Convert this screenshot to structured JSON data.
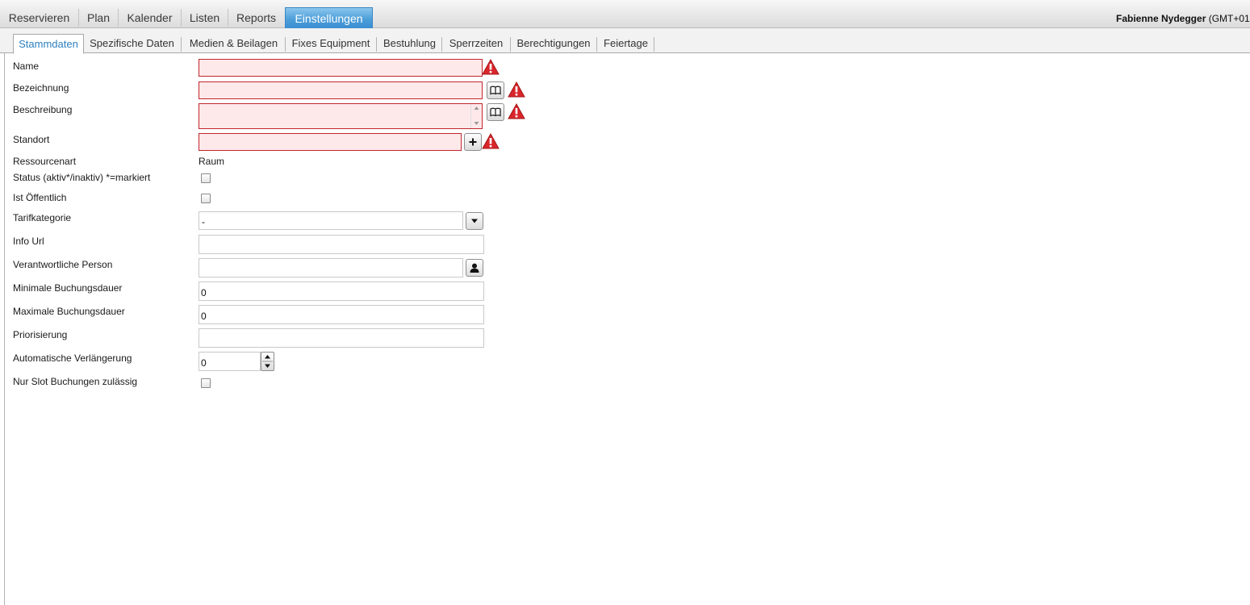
{
  "topnav": {
    "items": [
      "Reservieren",
      "Plan",
      "Kalender",
      "Listen",
      "Reports",
      "Einstellungen"
    ],
    "active": "Einstellungen",
    "user_name": "Fabienne Nydegger",
    "user_tz": "(GMT+01"
  },
  "subtabs": {
    "items": [
      "Stammdaten",
      "Spezifische Daten",
      "Medien & Beilagen",
      "Fixes Equipment",
      "Bestuhlung",
      "Sperrzeiten",
      "Berechtigungen",
      "Feiertage"
    ],
    "active": "Stammdaten"
  },
  "form": {
    "name_label": "Name",
    "bezeichnung_label": "Bezeichnung",
    "beschreibung_label": "Beschreibung",
    "standort_label": "Standort",
    "ressourcenart_label": "Ressourcenart",
    "ressourcenart_value": "Raum",
    "status_label": "Status (aktiv*/inaktiv) *=markiert",
    "oeffentlich_label": "Ist Öffentlich",
    "tarifkategorie_label": "Tarifkategorie",
    "tarifkategorie_value": "-",
    "info_url_label": "Info Url",
    "verantwortlich_label": "Verantwortliche Person",
    "min_dauer_label": "Minimale Buchungsdauer",
    "min_dauer_value": "0",
    "max_dauer_label": "Maximale Buchungsdauer",
    "max_dauer_value": "0",
    "priorisierung_label": "Priorisierung",
    "auto_verl_label": "Automatische Verlängerung",
    "auto_verl_value": "0",
    "slot_label": "Nur Slot Buchungen zulässig"
  },
  "icons": {
    "warning": "warning-icon",
    "translate": "book-icon",
    "add": "plus-icon",
    "dropdown": "chevron-down-icon",
    "person": "person-icon"
  },
  "colors": {
    "invalid_bg": "#fde8ea",
    "invalid_border": "#c0272d",
    "active_tab": "#4d9fd9",
    "warning": "#d9262b"
  }
}
